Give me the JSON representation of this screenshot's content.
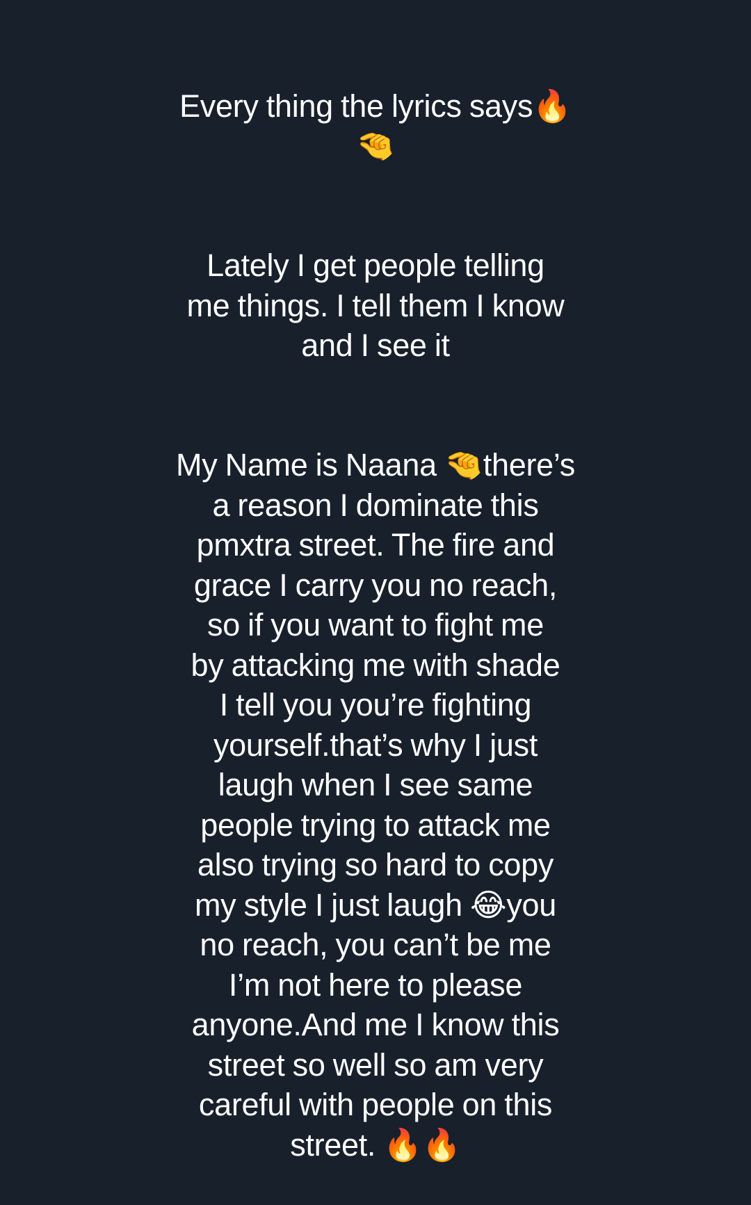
{
  "background_color": "#18202c",
  "text_color": "#ffffff",
  "caption": {
    "line1": "Every thing the lyrics says🔥\n🤏",
    "line2": "Lately I get people telling\nme things. I tell them I know\nand I see it",
    "line3": "My Name is Naana 🤏there’s\na reason I dominate this\npmxtra street. The fire and\ngrace I carry you no reach,\nso if you want to fight me\nby attacking me with shade\nI tell you you’re fighting\nyourself.that’s why I just\nlaugh when I see same\npeople trying to attack me\nalso trying so hard to copy\nmy style I just laugh 😂you\nno reach, you can’t be me\nI’m not here to please\nanyone.And me I know this\nstreet so well so am very\ncareful with people on this\nstreet. 🔥🔥"
  }
}
